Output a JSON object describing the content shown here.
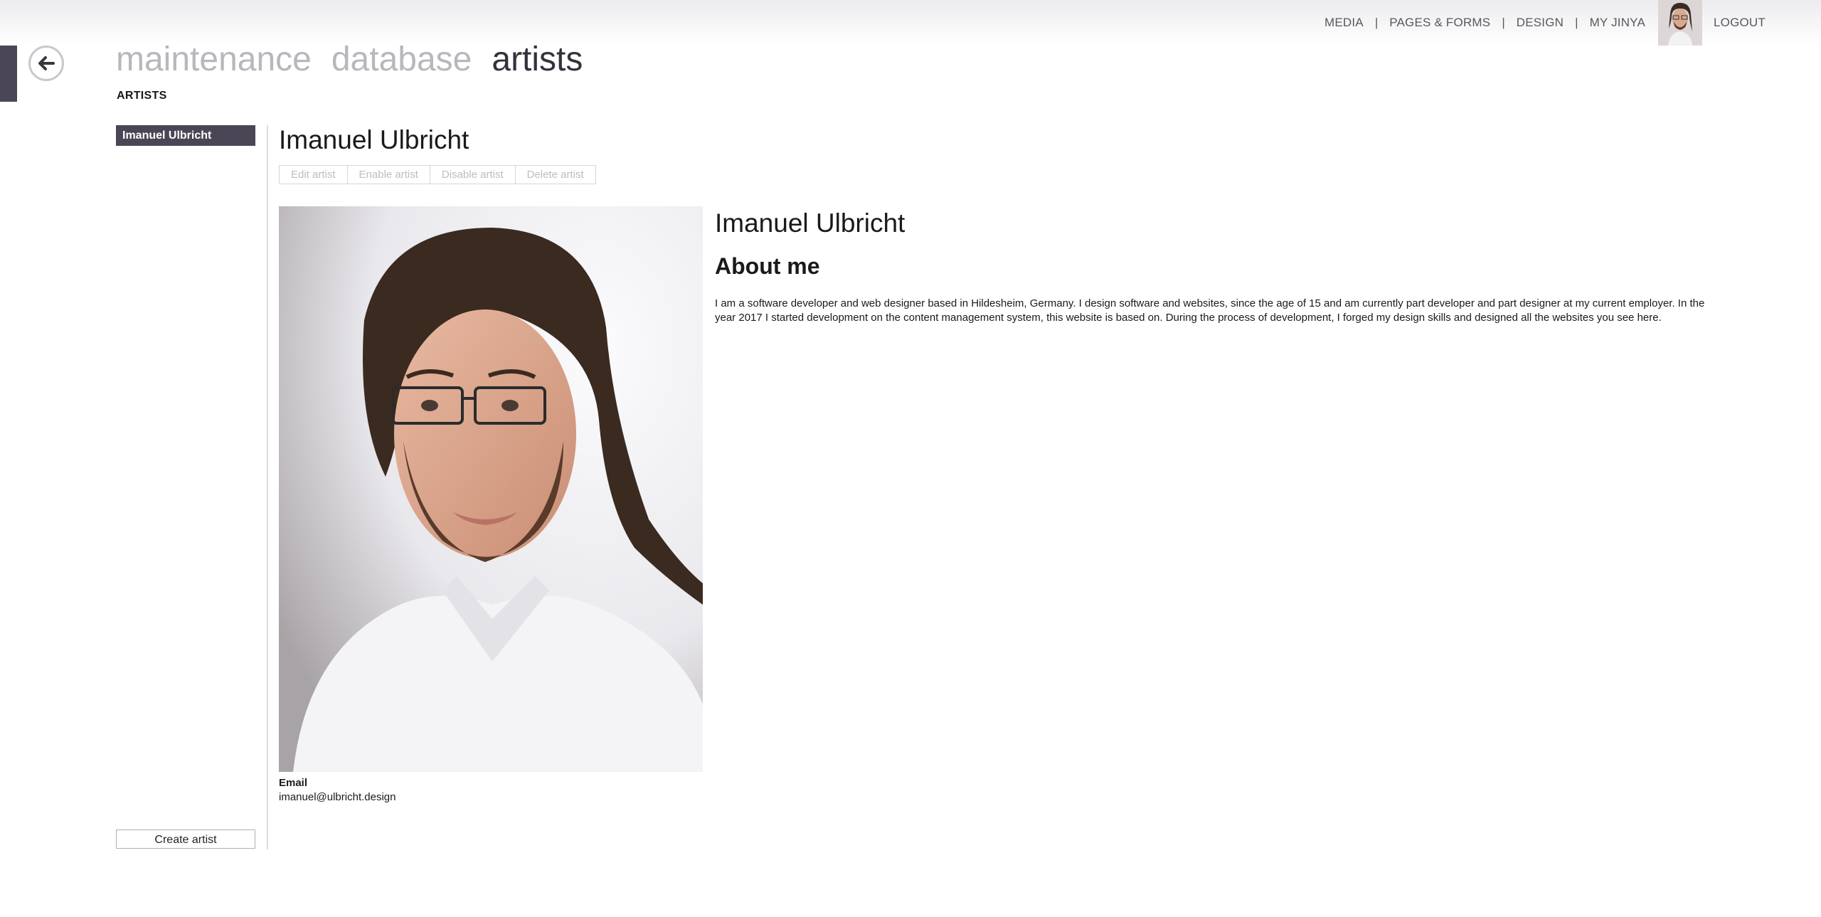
{
  "topnav": {
    "items": [
      "MEDIA",
      "PAGES & FORMS",
      "DESIGN",
      "MY JINYA"
    ],
    "separator": "|",
    "logout": "LOGOUT"
  },
  "breadcrumb": [
    "maintenance",
    "database",
    "artists"
  ],
  "subtitle": "ARTISTS",
  "sidebar": {
    "items": [
      {
        "label": "Imanuel Ulbricht",
        "selected": true
      }
    ],
    "create_label": "Create artist"
  },
  "detail": {
    "title": "Imanuel Ulbricht",
    "actions": [
      "Edit artist",
      "Enable artist",
      "Disable artist",
      "Delete artist"
    ],
    "bio_name": "Imanuel Ulbricht",
    "about_heading": "About me",
    "about_text": "I am a software developer and web designer based in Hildesheim, Germany. I design software and websites, since the age of 15 and am currently part developer and part designer at my current employer. In the year 2017 I started development on the content management system, this website is based on. During the process of development, I forged my design skills and designed all the websites you see here.",
    "email_label": "Email",
    "email": "imanuel@ulbricht.design"
  },
  "icons": {
    "back": "arrow-left-circle-icon",
    "avatar": "user-avatar"
  },
  "colors": {
    "accent": "#4b4655",
    "nav_text": "#5a5660",
    "breadcrumb_inactive": "#b9b6bd",
    "breadcrumb_active": "#35313c",
    "action_disabled_text": "#bdbdbd"
  }
}
